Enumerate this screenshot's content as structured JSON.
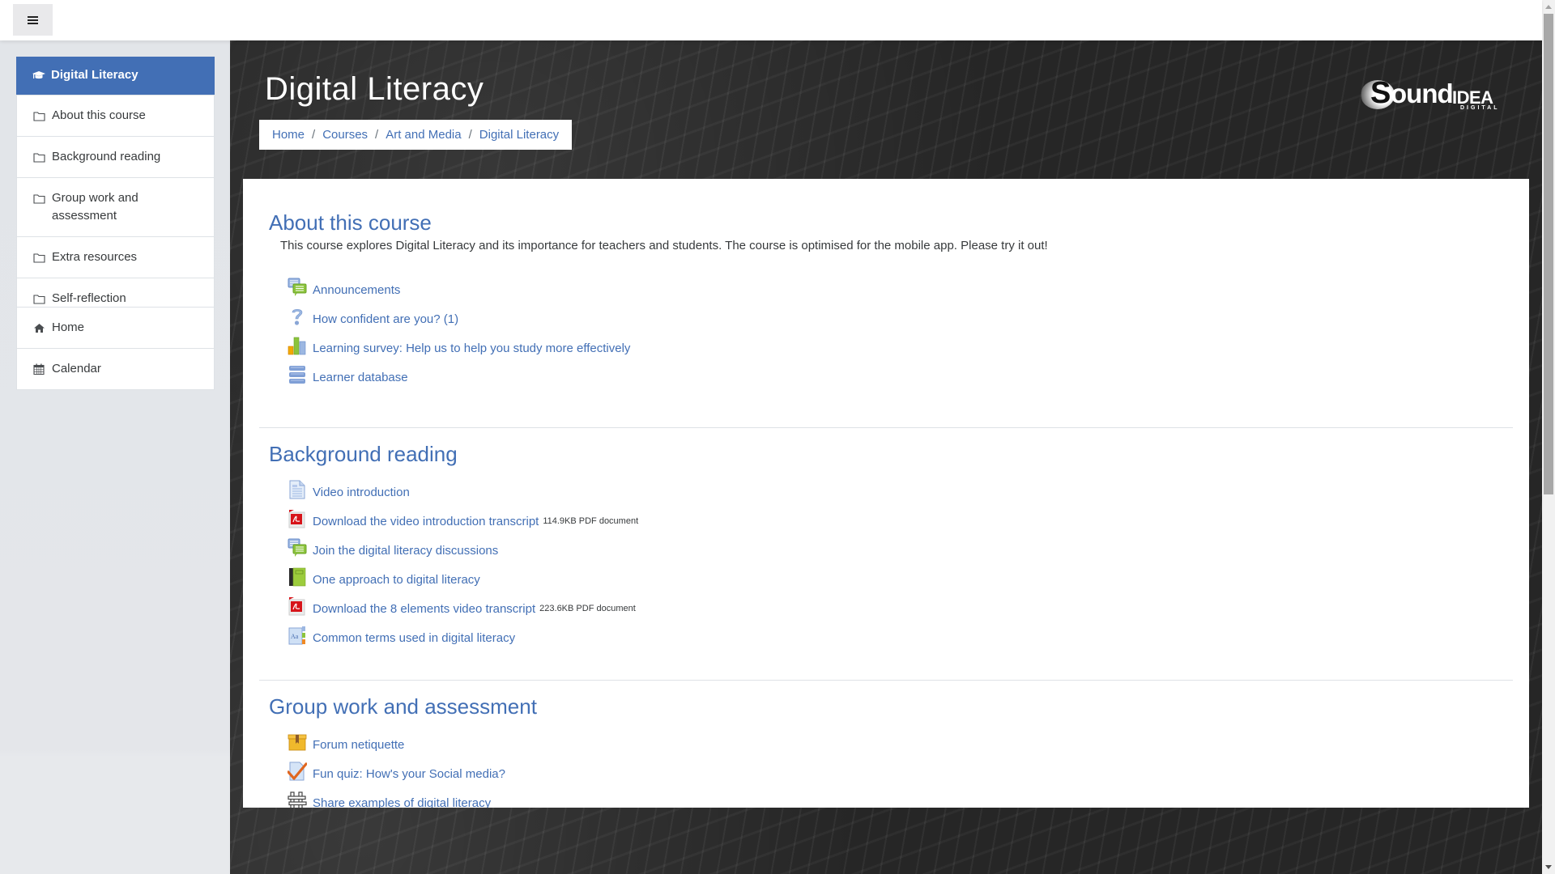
{
  "navbar": {
    "menu_button_icon": "hamburger-menu-icon"
  },
  "sidebar": {
    "course": {
      "label": "Digital Literacy",
      "icon": "graduation-cap-icon"
    },
    "sections": [
      {
        "label": "About this course",
        "icon": "folder-icon"
      },
      {
        "label": "Background reading",
        "icon": "folder-icon"
      },
      {
        "label": "Group work and assessment",
        "icon": "folder-icon"
      },
      {
        "label": "Extra resources",
        "icon": "folder-icon"
      },
      {
        "label": "Self-reflection",
        "icon": "folder-icon"
      }
    ],
    "links": [
      {
        "label": "Home",
        "icon": "home-icon"
      },
      {
        "label": "Calendar",
        "icon": "calendar-icon"
      }
    ]
  },
  "header": {
    "title": "Digital Literacy",
    "breadcrumb": [
      "Home",
      "Courses",
      "Art and Media",
      "Digital Literacy"
    ],
    "breadcrumb_separator": "/",
    "logo": {
      "main": "Sound",
      "s_letter": "S",
      "rest": "ound",
      "accent": "IDEA",
      "sub": "DIGITAL"
    }
  },
  "sections": [
    {
      "title": "About this course",
      "summary": "This course explores Digital Literacy and its importance for teachers and students. The course is optimised for the mobile app. Please try it out!",
      "activities": [
        {
          "label": "Announcements",
          "icon": "forum-icon"
        },
        {
          "label": "How confident are you? (1)",
          "icon": "question-icon"
        },
        {
          "label": "Learning survey: Help us to help you study more effectively",
          "icon": "survey-chart-icon"
        },
        {
          "label": "Learner database",
          "icon": "database-icon"
        }
      ]
    },
    {
      "title": "Background reading",
      "activities": [
        {
          "label": "Video introduction",
          "icon": "page-icon"
        },
        {
          "label": "Download the video introduction transcript",
          "icon": "pdf-icon",
          "meta": "114.9KB PDF document"
        },
        {
          "label": "Join the digital literacy discussions",
          "icon": "forum-icon"
        },
        {
          "label": "One approach to digital literacy",
          "icon": "book-icon"
        },
        {
          "label": "Download the 8 elements video transcript",
          "icon": "pdf-icon",
          "meta": "223.6KB PDF document"
        },
        {
          "label": "Common terms used in digital literacy",
          "icon": "glossary-icon"
        }
      ]
    },
    {
      "title": "Group work and assessment",
      "activities": [
        {
          "label": "Forum netiquette",
          "icon": "package-icon"
        },
        {
          "label": "Fun quiz: How's your Social media?",
          "icon": "quiz-icon"
        },
        {
          "label": "Share examples of digital literacy",
          "icon": "workshop-icon"
        }
      ]
    }
  ],
  "colors": {
    "accent": "#426fb5",
    "header_bg": "#262626",
    "drawer_bg": "#e7e9ec"
  }
}
